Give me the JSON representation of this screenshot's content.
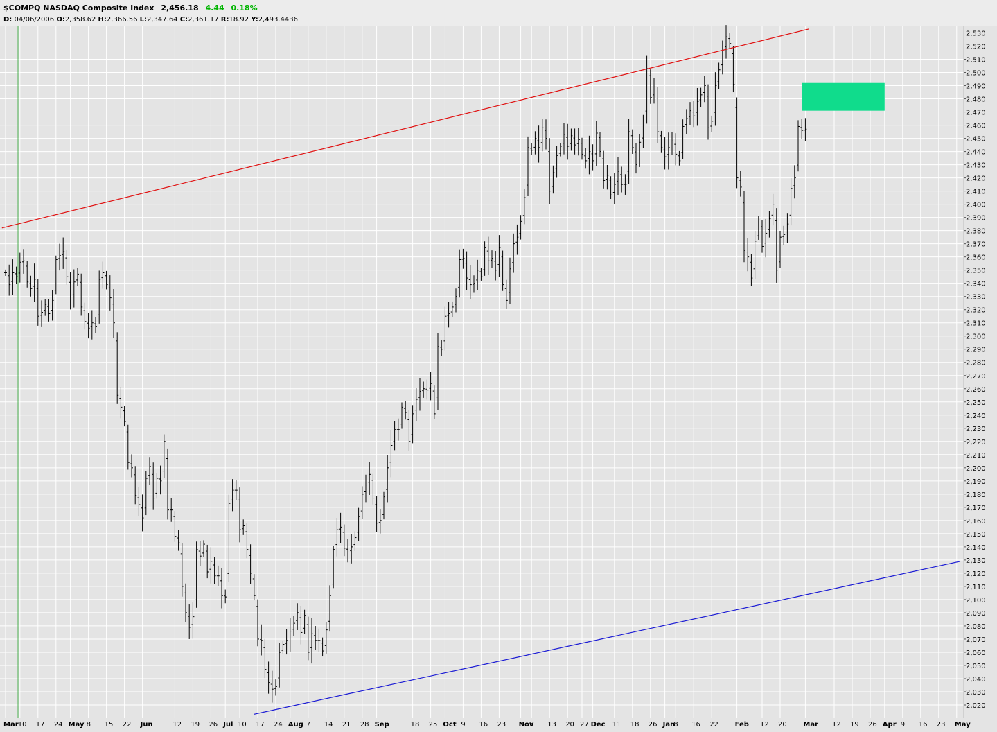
{
  "header": {
    "symbol_title": "$COMPQ NASDAQ Composite Index",
    "last": "2,456.18",
    "change": "4.44",
    "change_pct": "0.18%",
    "d_label": "D:",
    "d_value": "04/06/2006",
    "o_label": "O:",
    "o_value": "2,358.62",
    "h_label": "H:",
    "h_value": "2,366.56",
    "l_label": "L:",
    "l_value": "2,347.64",
    "c_label": "C:",
    "c_value": "2,361.17",
    "r_label": "R:",
    "r_value": "18.92",
    "y_label": "Y:",
    "y_value": "2,493.4436",
    "change_color": "#00b400"
  },
  "chart_data": {
    "type": "ohlc-bar",
    "title": "$COMPQ NASDAQ Composite Index",
    "ylim": [
      2010,
      2535
    ],
    "yticks": [
      2020,
      2030,
      2040,
      2050,
      2060,
      2070,
      2080,
      2090,
      2100,
      2110,
      2120,
      2130,
      2140,
      2150,
      2160,
      2170,
      2180,
      2190,
      2200,
      2210,
      2220,
      2230,
      2240,
      2250,
      2260,
      2270,
      2280,
      2290,
      2300,
      2310,
      2320,
      2330,
      2340,
      2350,
      2360,
      2370,
      2380,
      2390,
      2400,
      2410,
      2420,
      2430,
      2440,
      2450,
      2460,
      2470,
      2480,
      2490,
      2500,
      2510,
      2520,
      2530
    ],
    "ytick_labels": [
      "2,020",
      "2,030",
      "2,040",
      "2,050",
      "2,060",
      "2,070",
      "2,080",
      "2,090",
      "2,100",
      "2,110",
      "2,120",
      "2,130",
      "2,140",
      "2,150",
      "2,160",
      "2,170",
      "2,180",
      "2,190",
      "2,200",
      "2,210",
      "2,220",
      "2,230",
      "2,240",
      "2,250",
      "2,260",
      "2,270",
      "2,280",
      "2,290",
      "2,300",
      "2,310",
      "2,320",
      "2,330",
      "2,340",
      "2,350",
      "2,360",
      "2,370",
      "2,380",
      "2,390",
      "2,400",
      "2,410",
      "2,420",
      "2,430",
      "2,440",
      "2,450",
      "2,460",
      "2,470",
      "2,480",
      "2,490",
      "2,500",
      "2,510",
      "2,520",
      "2,530"
    ],
    "x_labels": [
      {
        "t": "Mar",
        "b": 0,
        "month": true
      },
      {
        "t": "10",
        "b": 4
      },
      {
        "t": "17",
        "b": 9
      },
      {
        "t": "24",
        "b": 14
      },
      {
        "t": "May",
        "b": 18,
        "month": true
      },
      {
        "t": "8",
        "b": 23
      },
      {
        "t": "15",
        "b": 28
      },
      {
        "t": "22",
        "b": 33
      },
      {
        "t": "Jun",
        "b": 38,
        "month": true
      },
      {
        "t": "12",
        "b": 47
      },
      {
        "t": "19",
        "b": 52
      },
      {
        "t": "26",
        "b": 57
      },
      {
        "t": "Jul",
        "b": 61,
        "month": true
      },
      {
        "t": "10",
        "b": 65
      },
      {
        "t": "17",
        "b": 70
      },
      {
        "t": "24",
        "b": 75
      },
      {
        "t": "Aug",
        "b": 79,
        "month": true
      },
      {
        "t": "7",
        "b": 84
      },
      {
        "t": "14",
        "b": 89
      },
      {
        "t": "21",
        "b": 94
      },
      {
        "t": "28",
        "b": 99
      },
      {
        "t": "Sep",
        "b": 103,
        "month": true
      },
      {
        "t": "18",
        "b": 113
      },
      {
        "t": "25",
        "b": 118
      },
      {
        "t": "Oct",
        "b": 122,
        "month": true
      },
      {
        "t": "9",
        "b": 127
      },
      {
        "t": "16",
        "b": 132
      },
      {
        "t": "23",
        "b": 137
      },
      {
        "t": "Nov",
        "b": 143,
        "month": true
      },
      {
        "t": "6",
        "b": 146
      },
      {
        "t": "13",
        "b": 151
      },
      {
        "t": "20",
        "b": 156
      },
      {
        "t": "27",
        "b": 160
      },
      {
        "t": "Dec",
        "b": 163,
        "month": true
      },
      {
        "t": "11",
        "b": 169
      },
      {
        "t": "18",
        "b": 174
      },
      {
        "t": "26",
        "b": 179
      },
      {
        "t": "Jan",
        "b": 183,
        "month": true
      },
      {
        "t": "8",
        "b": 186
      },
      {
        "t": "16",
        "b": 191
      },
      {
        "t": "22",
        "b": 196
      },
      {
        "t": "Feb",
        "b": 203,
        "month": true
      },
      {
        "t": "12",
        "b": 210
      },
      {
        "t": "20",
        "b": 215
      },
      {
        "t": "Mar",
        "b": 222,
        "month": true
      },
      {
        "t": "12",
        "b": 230
      },
      {
        "t": "19",
        "b": 235
      },
      {
        "t": "26",
        "b": 240
      },
      {
        "t": "Apr",
        "b": 244,
        "month": true
      },
      {
        "t": "9",
        "b": 249
      },
      {
        "t": "16",
        "b": 254
      },
      {
        "t": "23",
        "b": 259
      },
      {
        "t": "May",
        "b": 264,
        "month": true
      }
    ],
    "trendlines": [
      {
        "name": "resistance",
        "color": "#e01010",
        "from": {
          "b": -1,
          "y": 2382
        },
        "to": {
          "b": 223,
          "y": 2533
        }
      },
      {
        "name": "support",
        "color": "#1a1ad4",
        "from": {
          "b": 69,
          "y": 2013
        },
        "to": {
          "b": 265,
          "y": 2129
        }
      }
    ],
    "zone": {
      "color": "#10dc8c",
      "b0": 221,
      "b1": 244,
      "y0": 2471,
      "y1": 2492
    },
    "closes": [
      2348,
      2339,
      2348,
      2345,
      2356,
      2357,
      2341,
      2336,
      2343,
      2315,
      2318,
      2324,
      2317,
      2327,
      2358,
      2361,
      2364,
      2345,
      2328,
      2341,
      2347,
      2322,
      2311,
      2306,
      2310,
      2307,
      2343,
      2348,
      2339,
      2329,
      2310,
      2255,
      2246,
      2235,
      2204,
      2200,
      2179,
      2172,
      2162,
      2192,
      2201,
      2177,
      2192,
      2190,
      2220,
      2168,
      2168,
      2148,
      2143,
      2110,
      2090,
      2079,
      2087,
      2138,
      2133,
      2142,
      2121,
      2129,
      2118,
      2118,
      2103,
      2102,
      2173,
      2183,
      2183,
      2153,
      2156,
      2138,
      2120,
      2103,
      2070,
      2069,
      2047,
      2037,
      2032,
      2034,
      2060,
      2066,
      2069,
      2076,
      2082,
      2090,
      2075,
      2088,
      2060,
      2074,
      2069,
      2069,
      2061,
      2077,
      2103,
      2138,
      2153,
      2155,
      2139,
      2136,
      2140,
      2147,
      2163,
      2180,
      2187,
      2195,
      2177,
      2158,
      2160,
      2178,
      2200,
      2217,
      2229,
      2229,
      2246,
      2242,
      2220,
      2241,
      2252,
      2258,
      2260,
      2259,
      2264,
      2241,
      2292,
      2290,
      2315,
      2317,
      2322,
      2330,
      2358,
      2359,
      2344,
      2339,
      2340,
      2350,
      2345,
      2367,
      2357,
      2359,
      2350,
      2367,
      2339,
      2327,
      2351,
      2370,
      2375,
      2387,
      2405,
      2443,
      2441,
      2450,
      2443,
      2458,
      2450,
      2410,
      2424,
      2437,
      2444,
      2453,
      2444,
      2452,
      2445,
      2449,
      2438,
      2433,
      2440,
      2433,
      2454,
      2440,
      2418,
      2422,
      2407,
      2415,
      2425,
      2415,
      2415,
      2455,
      2443,
      2430,
      2447,
      2460,
      2503,
      2481,
      2489,
      2455,
      2443,
      2436,
      2443,
      2448,
      2438,
      2433,
      2459,
      2465,
      2471,
      2467,
      2478,
      2483,
      2490,
      2458,
      2463,
      2490,
      2502,
      2517,
      2527,
      2522,
      2491,
      2420,
      2413,
      2365,
      2360,
      2344,
      2372,
      2388,
      2368,
      2378,
      2389,
      2400,
      2350,
      2375,
      2377,
      2385,
      2412,
      2420,
      2459,
      2456,
      2457
    ]
  }
}
